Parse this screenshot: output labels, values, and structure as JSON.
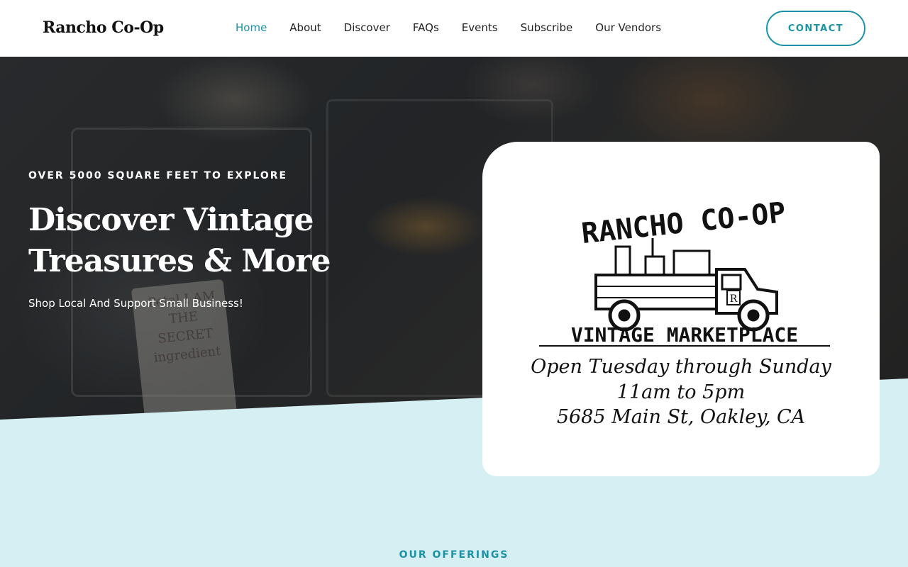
{
  "header": {
    "brand": "Rancho Co-Op",
    "nav": [
      {
        "label": "Home",
        "active": true
      },
      {
        "label": "About"
      },
      {
        "label": "Discover"
      },
      {
        "label": "FAQs"
      },
      {
        "label": "Events"
      },
      {
        "label": "Subscribe"
      },
      {
        "label": "Our Vendors"
      }
    ],
    "contact_label": "CONTACT"
  },
  "hero": {
    "eyebrow": "OVER 5000 SQUARE FEET TO EXPLORE",
    "headline": "Discover Vintage Treasures & More",
    "subtext": "Shop Local And Support Small Business!",
    "background_towel_text": "Petal I AM THE SECRET ingredient"
  },
  "card": {
    "logo_title": "RANCHO CO-OP",
    "logo_truck_letter": "R",
    "logo_subtitle": "VINTAGE MARKETPLACE",
    "line1": "Open Tuesday through Sunday",
    "line2": "11am to 5pm",
    "line3": "5685 Main St, Oakley, CA"
  },
  "section": {
    "offerings_label": "OUR OFFERINGS"
  },
  "colors": {
    "accent": "#1a93a6",
    "section_bg": "#d6eff3",
    "header_bg": "#ffffff"
  }
}
